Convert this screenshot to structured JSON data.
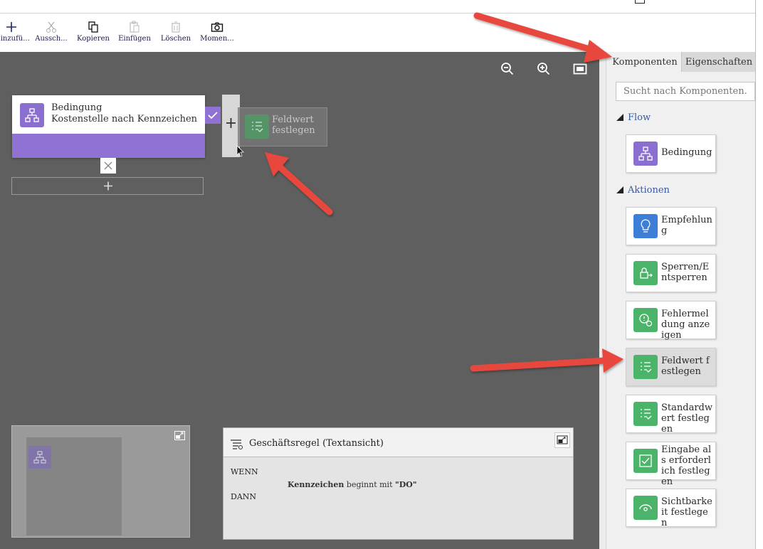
{
  "toolbar": {
    "items": [
      {
        "label": "Hinzufü...",
        "icon": "plus-icon"
      },
      {
        "label": "Aussch...",
        "icon": "scissors-icon"
      },
      {
        "label": "Kopieren",
        "icon": "copy-icon"
      },
      {
        "label": "Einfügen",
        "icon": "paste-icon"
      },
      {
        "label": "Löschen",
        "icon": "trash-icon"
      },
      {
        "label": "Momen...",
        "icon": "camera-icon"
      }
    ]
  },
  "canvas": {
    "node": {
      "title": "Bedingung",
      "subtitle": "Kostenstelle nach Kennzeichen",
      "icon": "flow-condition-icon",
      "band_color": "#8f72d3"
    },
    "drag_preview": {
      "line1": "Feldwert",
      "line2": "festlegen"
    }
  },
  "textview": {
    "title": "Geschäftsregel (Textansicht)",
    "wenn": "WENN",
    "field": "Kennzeichen",
    "condition": " beginnt mit ",
    "value": "\"DO\"",
    "dann": "DANN"
  },
  "sidebar": {
    "tabs": [
      {
        "label": "Komponenten",
        "active": true
      },
      {
        "label": "Eigenschaften",
        "active": false
      }
    ],
    "search_placeholder": "Sucht nach Komponenten....",
    "sections": [
      {
        "title": "Flow"
      },
      {
        "title": "Aktionen"
      }
    ],
    "flow_items": [
      {
        "label": "Bedingung",
        "color": "#8a6fd0",
        "icon": "flow-condition-icon"
      }
    ],
    "action_items": [
      {
        "label": "Empfehlung",
        "color": "#3d7fd6",
        "icon": "lightbulb-icon"
      },
      {
        "label": "Sperren/Entsperren",
        "color": "#4cb46a",
        "icon": "lock-toggle-icon"
      },
      {
        "label": "Fehlermeldung anzeigen",
        "color": "#4cb46a",
        "icon": "error-message-icon"
      },
      {
        "label": "Feldwert festlegen",
        "color": "#4cb46a",
        "icon": "set-field-value-icon",
        "selected": true
      },
      {
        "label": "Standardwert festlegen",
        "color": "#4cb46a",
        "icon": "set-default-value-icon"
      },
      {
        "label": "Eingabe als erforderlich festlegen",
        "color": "#4cb46a",
        "icon": "required-checkbox-icon"
      },
      {
        "label": "Sichtbarkeit festlegen",
        "color": "#4cb46a",
        "icon": "eye-icon"
      }
    ]
  },
  "colors": {
    "canvas_bg": "#5f5f5f",
    "accent_purple": "#8a6fd0",
    "accent_green": "#4cb46a",
    "accent_blue": "#3d7fd6",
    "arrow_red": "#e8473c"
  }
}
